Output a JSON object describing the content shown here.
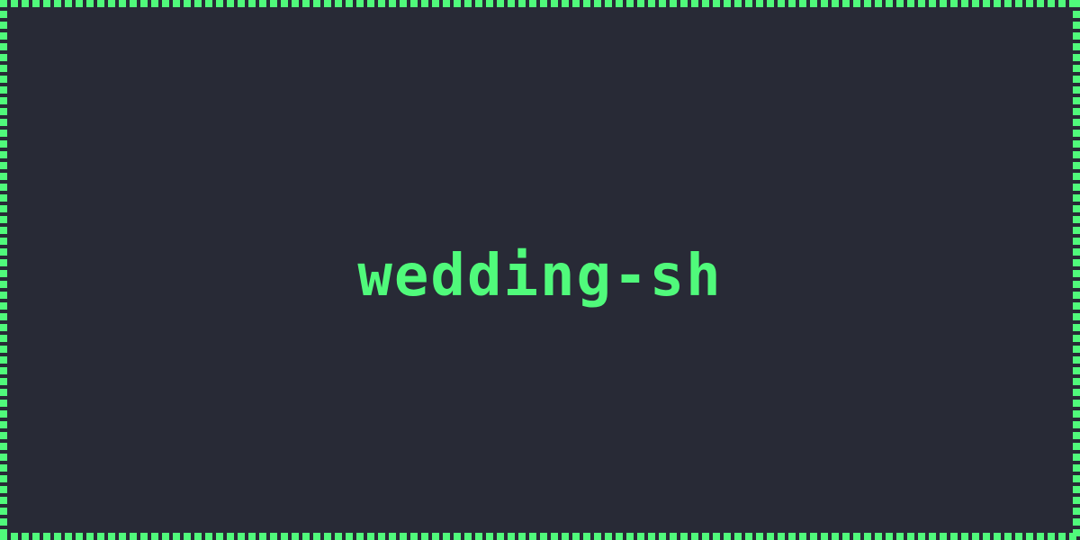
{
  "title": "wedding-sh",
  "colors": {
    "background": "#282a36",
    "accent": "#50fa7b"
  }
}
